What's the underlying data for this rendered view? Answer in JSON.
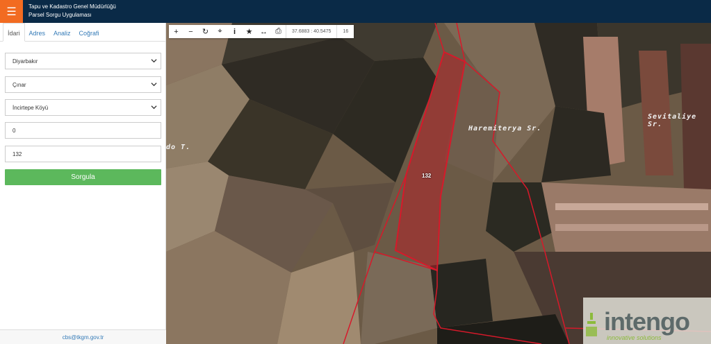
{
  "header": {
    "menu_icon": "hamburger-icon",
    "title_line1": "Tapu ve Kadastro Genel Müdürlüğü",
    "title_line2": "Parsel Sorgu Uygulaması"
  },
  "sidebar": {
    "tabs": [
      {
        "label": "İdari",
        "active": true
      },
      {
        "label": "Adres",
        "active": false
      },
      {
        "label": "Analiz",
        "active": false
      },
      {
        "label": "Coğrafi",
        "active": false
      }
    ],
    "province": "Diyarbakır",
    "district": "Çınar",
    "village": "İncirtepe Köyü",
    "block": "0",
    "parcel": "132",
    "query_button": "Sorgula",
    "footer_email": "cbs@tkgm.gov.tr"
  },
  "map": {
    "toolbar": {
      "coords": "37.6883 : 40.5475",
      "zoom": "16"
    },
    "labels": {
      "left_place": "do T.",
      "center_place": "Haremiterya Sr.",
      "right_place": "Sevitaliye Sr."
    },
    "parcel_label": "132",
    "logo": {
      "name": "intengo",
      "tagline": "innovative solutions"
    },
    "colors": {
      "parcel_fill": "#b3242a",
      "boundary": "#d7192a"
    }
  }
}
